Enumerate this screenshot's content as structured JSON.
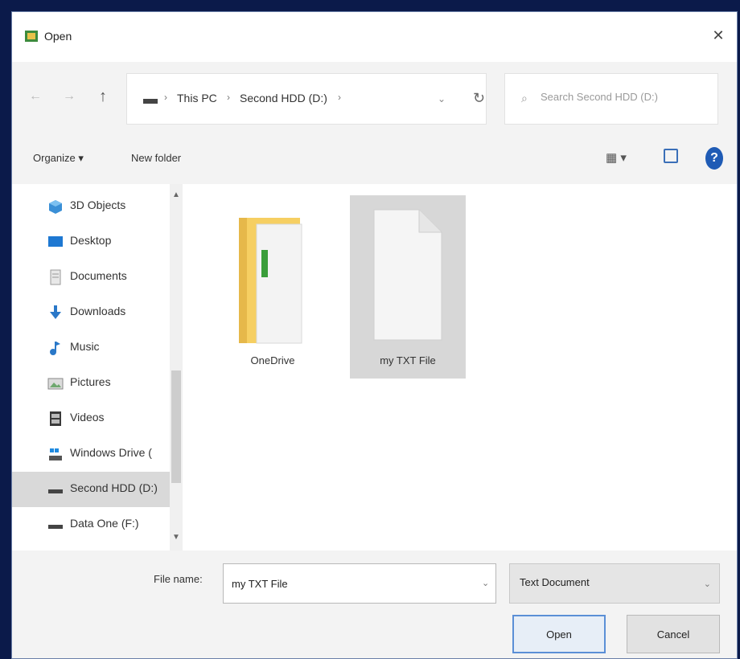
{
  "window": {
    "title": "Open",
    "close_icon": "✕"
  },
  "nav_buttons": {
    "back": "←",
    "forward": "→",
    "up": "↑"
  },
  "address": {
    "crumbs": [
      "This PC",
      "Second HDD (D:)"
    ],
    "separator": "›",
    "dropdown": "⌄",
    "refresh": "↻"
  },
  "search": {
    "placeholder": "Search Second HDD (D:)"
  },
  "toolbar": {
    "organize": "Organize ▾",
    "new_folder": "New folder",
    "view": "▦ ▾",
    "help": "?"
  },
  "sidebar": {
    "items": [
      {
        "label": "3D Objects",
        "icon": "cube-icon"
      },
      {
        "label": "Desktop",
        "icon": "desktop-icon"
      },
      {
        "label": "Documents",
        "icon": "documents-icon"
      },
      {
        "label": "Downloads",
        "icon": "downloads-icon"
      },
      {
        "label": "Music",
        "icon": "music-icon"
      },
      {
        "label": "Pictures",
        "icon": "pictures-icon"
      },
      {
        "label": "Videos",
        "icon": "videos-icon"
      },
      {
        "label": "Windows Drive (",
        "icon": "windows-drive-icon"
      },
      {
        "label": "Second HDD (D:)",
        "icon": "drive-icon"
      },
      {
        "label": "Data One (F:)",
        "icon": "drive-icon"
      }
    ],
    "selected_index": 8
  },
  "files": [
    {
      "name": "OneDrive",
      "type": "folder"
    },
    {
      "name": "my TXT File",
      "type": "document"
    }
  ],
  "bottom": {
    "file_name_label": "File name:",
    "file_name_value": "my TXT File",
    "file_type": "Text Document",
    "open_button": "Open",
    "cancel_button": "Cancel"
  }
}
